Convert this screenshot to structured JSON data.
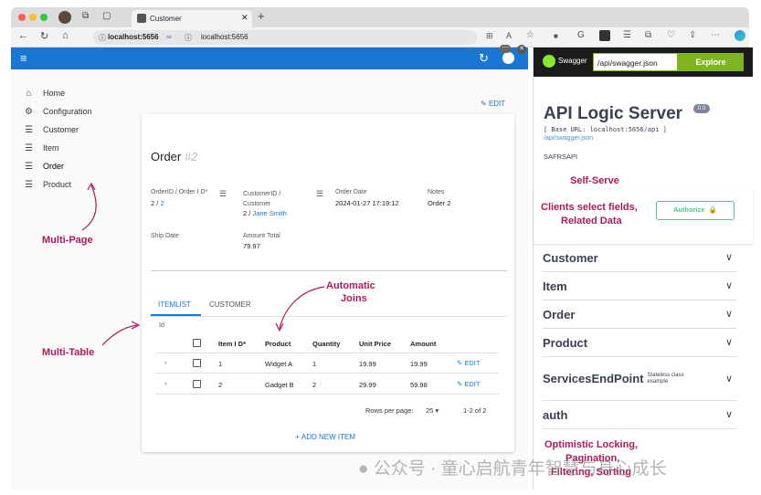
{
  "browser": {
    "tab_title": "Customer",
    "url": "localhost:5656",
    "url_info": "localhost:5656"
  },
  "sidebar": {
    "items": [
      {
        "label": "Home",
        "icon": "home-icon"
      },
      {
        "label": "Configuration",
        "icon": "gear-icon"
      },
      {
        "label": "Customer",
        "icon": "list-icon"
      },
      {
        "label": "Item",
        "icon": "list-icon"
      },
      {
        "label": "Order",
        "icon": "list-icon"
      },
      {
        "label": "Product",
        "icon": "list-icon"
      }
    ]
  },
  "record": {
    "edit_label": "EDIT",
    "title": "Order",
    "title_id": "#2",
    "fields": {
      "orderid_label": "OrderID / Order I D*",
      "orderid_value_a": "2 / ",
      "orderid_value_b": "2",
      "customer_label": "CustomerID / Customer",
      "customer_value_a": "2 / ",
      "customer_value_b": "Jane Smith",
      "orderdate_label": "Order Date",
      "orderdate_value": "2024-01-27 17:19:12",
      "notes_label": "Notes",
      "notes_value": "Order 2",
      "shipdate_label": "Ship Date",
      "amount_label": "Amount Total",
      "amount_value": "79.97"
    },
    "tabs": [
      "ITEMLIST",
      "CUSTOMER"
    ],
    "id_label": "Id",
    "table": {
      "headers": [
        "Item I D*",
        "Product",
        "Quantity",
        "Unit Price",
        "Amount"
      ],
      "rows": [
        {
          "item": "1",
          "product": "Widget A",
          "quantity": "1",
          "unit_price": "19.99",
          "amount": "19.99",
          "edit": "EDIT"
        },
        {
          "item": "2",
          "product": "Gadget B",
          "quantity": "2",
          "unit_price": "29.99",
          "amount": "59.98",
          "edit": "EDIT"
        }
      ]
    },
    "pagination": {
      "rows_label": "Rows per page:",
      "rows_value": "25",
      "range": "1-2 of 2"
    },
    "add_label": "ADD NEW ITEM"
  },
  "annotations": {
    "multi_page": "Multi-Page",
    "automatic_joins_1": "Automatic",
    "automatic_joins_2": "Joins",
    "multi_table": "Multi-Table",
    "self_serve": "Self-Serve",
    "clients_1": "Clients select fields,",
    "clients_2": "Related Data",
    "optimistic_1": "Optimistic Locking,",
    "optimistic_2": "Pagination,",
    "optimistic_3": "Filtering, Sorting"
  },
  "swagger": {
    "logo_text": "Swagger",
    "url_value": "/api/swagger.json",
    "explore_label": "Explore",
    "title": "API Logic Server",
    "version": "0.0",
    "base_url": "[ Base URL: localhost:5656/api ]",
    "json_link": "/api/swagger.json",
    "safrs": "SAFRSAPI",
    "authorize_label": "Authorize",
    "sections": [
      {
        "name": "Customer"
      },
      {
        "name": "Item"
      },
      {
        "name": "Order"
      },
      {
        "name": "Product"
      },
      {
        "name": "ServicesEndPoint",
        "sub_1": "Stateless class",
        "sub_2": "example"
      },
      {
        "name": "auth"
      }
    ]
  },
  "watermark": "公众号 · 童心启航青年智慧与身心成长",
  "colors": {
    "accent": "#1976d2",
    "annotation": "#b0195c",
    "swagger_green": "#49cc90",
    "explore": "#7fb51e"
  }
}
